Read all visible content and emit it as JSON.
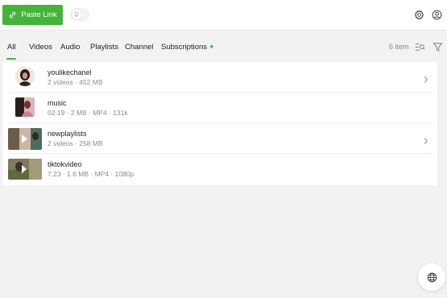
{
  "toolbar": {
    "paste_link_label": "Paste Link",
    "accent_color": "#44b33a"
  },
  "tabs": [
    {
      "label": "All",
      "active": true
    },
    {
      "label": "Videos",
      "active": false
    },
    {
      "label": "Audio",
      "active": false
    },
    {
      "label": "Playlists",
      "active": false
    },
    {
      "label": "Channel",
      "active": false
    },
    {
      "label": "Subscriptions",
      "active": false
    }
  ],
  "item_count": "6 item",
  "items": [
    {
      "title": "youlikechanel",
      "meta": "2 videos · 452 MB",
      "type": "channel",
      "has_chevron": true
    },
    {
      "title": "music",
      "meta": "02:19 · 2 MB · MP4 · 131k",
      "type": "video",
      "has_chevron": false
    },
    {
      "title": "newplaylists",
      "meta": "2 videos · 258 MB",
      "type": "playlist",
      "has_chevron": true
    },
    {
      "title": "tiktokvideo",
      "meta": "7:23 · 1.6 MB · MP4 · 1080p",
      "type": "video",
      "has_chevron": false
    }
  ],
  "icons": {
    "paste": "link-icon",
    "toggle": "lightbulb-icon",
    "settings": "gear-icon",
    "account": "user-circle-icon",
    "search": "search-list-icon",
    "filter": "filter-icon",
    "globe": "globe-icon",
    "chevron": "chevron-right-icon"
  }
}
